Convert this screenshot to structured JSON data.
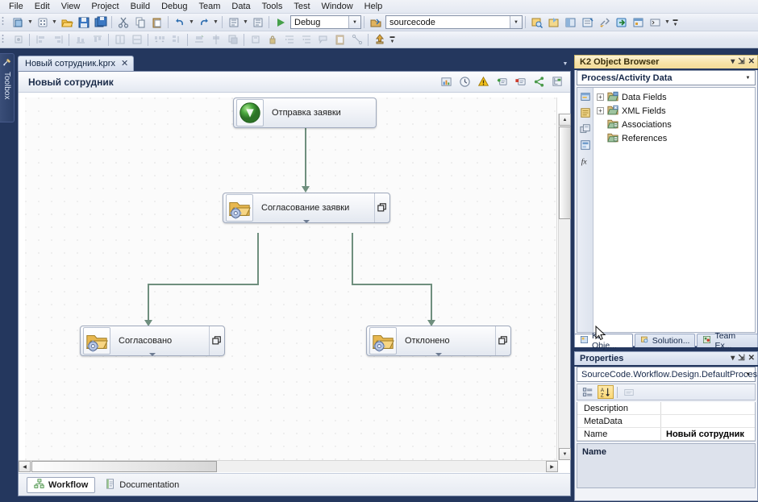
{
  "menubar": {
    "items": [
      {
        "label": "File"
      },
      {
        "label": "Edit"
      },
      {
        "label": "View"
      },
      {
        "label": "Project"
      },
      {
        "label": "Build"
      },
      {
        "label": "Debug"
      },
      {
        "label": "Team"
      },
      {
        "label": "Data"
      },
      {
        "label": "Tools"
      },
      {
        "label": "Test"
      },
      {
        "label": "Window"
      },
      {
        "label": "Help"
      }
    ]
  },
  "toolbar": {
    "config_combo": {
      "value": "Debug"
    },
    "source_combo": {
      "value": "sourcecode"
    },
    "row1_icons": [
      "new-project-icon",
      "new-item-icon",
      "open-file-icon",
      "save-icon",
      "save-all-icon",
      "cut-icon",
      "copy-icon",
      "paste-icon",
      "undo-icon",
      "redo-icon",
      "navigate-backward-icon",
      "navigate-forward-icon",
      "start-debug-icon"
    ],
    "row1_right_icons": [
      "open-solution-icon",
      "find-in-files-icon",
      "new-window-icon",
      "toolbox-window-icon",
      "properties-window-icon",
      "build-tools-icon",
      "step-into-icon",
      "object-browser-icon",
      "command-window-icon"
    ],
    "row2_icons": [
      "align-to-grid-icon",
      "align-lefts-icon",
      "align-rights-icon",
      "align-bottoms-icon",
      "align-tops-icon",
      "make-same-width-icon",
      "make-same-height-icon",
      "horizontal-spacing-icon",
      "vertical-spacing-icon",
      "center-horizontally-icon",
      "center-vertically-icon",
      "bring-to-front-icon",
      "send-to-back-icon",
      "tab-order-icon",
      "lock-controls-icon",
      "increase-indent-icon",
      "decrease-indent-icon",
      "comment-icon",
      "uncomment-icon",
      "bookmark-icon"
    ],
    "row2_right_icons": [
      "clipboard-ring-icon",
      "connector-icon",
      "publish-icon"
    ]
  },
  "toolbox_tab": {
    "label": "Toolbox",
    "icon": "toolbox-icon"
  },
  "document_tab": {
    "title": "Новый сотрудник.kprx",
    "close": "✕"
  },
  "designer": {
    "title": "Новый сотрудник",
    "header_icons": [
      "view-chart-icon",
      "history-clock-icon",
      "warning-icon",
      "add-activity-icon",
      "remove-activity-icon",
      "branch-icon",
      "hierarchy-icon"
    ],
    "nodes": [
      {
        "id": "start",
        "label": "Отправка заявки",
        "icon": "green-start-event-icon",
        "has_expand": false,
        "has_caret": false
      },
      {
        "id": "approval",
        "label": "Согласование заявки",
        "icon": "folder-gear-activity-icon",
        "has_expand": true,
        "has_caret": true
      },
      {
        "id": "approved",
        "label": "Согласовано",
        "icon": "folder-gear-activity-icon",
        "has_expand": true,
        "has_caret": true
      },
      {
        "id": "rejected",
        "label": "Отклонено",
        "icon": "folder-gear-activity-icon",
        "has_expand": true,
        "has_caret": true
      }
    ],
    "connector_color": "#6f8f7e",
    "footer_tabs": [
      {
        "label": "Workflow",
        "icon": "workflow-icon",
        "active": true
      },
      {
        "label": "Documentation",
        "icon": "documentation-icon",
        "active": false
      }
    ]
  },
  "object_browser": {
    "title": "K2 Object Browser",
    "header_buttons": [
      "dropdown-menu-icon",
      "pin-icon",
      "close-icon"
    ],
    "context_dropdown": "Process/Activity Data",
    "side_icons": [
      "environment-fields-icon",
      "process-activity-data-icon",
      "workflow-context-icon",
      "smartobject-server-icon",
      "functions-fx-icon"
    ],
    "tree": [
      {
        "label": "Data Fields",
        "icon": "folder-data-icon",
        "expander": "+"
      },
      {
        "label": "XML Fields",
        "icon": "folder-xml-icon",
        "expander": "+"
      },
      {
        "label": "Associations",
        "icon": "folder-assoc-icon",
        "expander": ""
      },
      {
        "label": "References",
        "icon": "folder-ref-icon",
        "expander": ""
      }
    ],
    "dock_tabs": [
      {
        "label": "K2 Obje...",
        "icon": "k2-object-browser-icon",
        "active": true
      },
      {
        "label": "Solution...",
        "icon": "solution-explorer-icon",
        "active": false
      },
      {
        "label": "Team Ex...",
        "icon": "team-explorer-icon",
        "active": false
      }
    ]
  },
  "properties": {
    "title": "Properties",
    "header_buttons": [
      "dropdown-menu-icon",
      "pin-icon",
      "close-icon"
    ],
    "object_selector": "SourceCode.Workflow.Design.DefaultProces",
    "toolbar_icons": [
      "categorized-icon",
      "alphabetical-icon",
      "property-pages-icon"
    ],
    "rows": [
      {
        "name": "Description",
        "value": "",
        "bold": false
      },
      {
        "name": "MetaData",
        "value": "",
        "bold": false
      },
      {
        "name": "Name",
        "value": "Новый сотрудник",
        "bold": true
      }
    ],
    "description_title": "Name",
    "description_text": ""
  },
  "cursor": {
    "icon": "mouse-pointer-icon"
  }
}
